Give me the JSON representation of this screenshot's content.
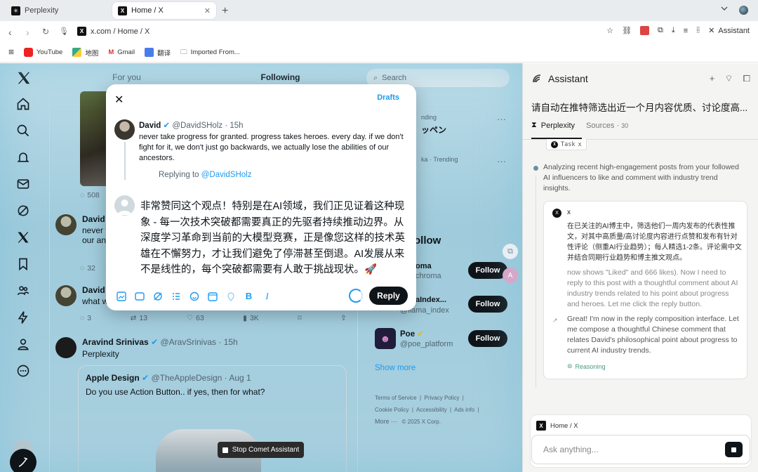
{
  "browser": {
    "tabs": [
      {
        "label": "Perplexity"
      },
      {
        "label": "Home / X"
      }
    ],
    "url": "x.com / Home / X",
    "assistant_label": "Assistant",
    "bookmarks": [
      "YouTube",
      "地图",
      "Gmail",
      "翻译",
      "Imported From..."
    ]
  },
  "x": {
    "feed_tabs": [
      "For you",
      "Following"
    ],
    "search_placeholder": "Search",
    "posts": [
      {
        "name": "David",
        "snippet": [
          "never ta",
          "our anc"
        ],
        "reply_count": "32"
      },
      {
        "name": "David",
        "snippet": [
          "what wa"
        ],
        "reply_count": "3",
        "repost_count": "13",
        "like_count": "63",
        "view_count": "3K"
      }
    ],
    "top_metric": "508",
    "aravind": {
      "name": "Aravind Srinivas",
      "handle": "@AravSrinivas",
      "time": "15h",
      "text": "Perplexity"
    },
    "quoted": {
      "name": "Apple Design",
      "handle": "@TheAppleDesign",
      "time": "Aug 1",
      "text": "Do you use Action Button.. if yes, then for what?"
    },
    "trending": [
      {
        "sub": "nding",
        "main": "ッペン"
      },
      {
        "sub": "ka · Trending",
        "main": ""
      }
    ],
    "who_title": "ollow",
    "who": [
      {
        "name": "oma",
        "handle": "chroma",
        "follow": "Follow"
      },
      {
        "name": "aIndex...",
        "handle": "@llama_index",
        "follow": "Follow"
      },
      {
        "name": "Poe",
        "handle": "@poe_platform",
        "follow": "Follow"
      }
    ],
    "show_more": "Show more",
    "footer": [
      "Terms of Service",
      "Privacy Policy",
      "Cookie Policy",
      "Accessibility",
      "Ads info",
      "More ···",
      "© 2025 X Corp."
    ]
  },
  "modal": {
    "drafts": "Drafts",
    "orig_name": "David",
    "orig_handle": "@DavidSHolz · 15h",
    "orig_text": "never take progress for granted. progress takes heroes. every day. if we don't fight for it, we don't just go backwards, we actually lose the abilities of our ancestors.",
    "replying_prefix": "Replying to ",
    "replying_handle": "@DavidSHolz",
    "compose_text": "非常赞同这个观点！特别是在AI领域，我们正见证着这种现象 - 每一次技术突破都需要真正的先驱者持续推动边界。从深度学习革命到当前的大模型竞赛，正是像您这样的技术英雄在不懈努力，才让我们避免了停滞甚至倒退。AI发展从来不是线性的，每个突破都需要有人敢于挑战现状。🚀",
    "reply_button": "Reply"
  },
  "stop_button": "Stop Comet Assistant",
  "assistant": {
    "title": "Assistant",
    "query": "请自动在推特筛选出近一个月内容优质、讨论度高...",
    "tab_perplexity": "Perplexity",
    "tab_sources": "Sources",
    "sources_count": "30",
    "task_chip": "Task",
    "task_chip_x": "x",
    "analyzing": "Analyzing recent high-engagement posts from your followed AI influencers to like and comment with industry trend insights.",
    "card_label": "x",
    "card_cn": "在已关注的AI博主中，筛选他们一周内发布的代表性推文，对其中高质量/高讨论度内容进行点赞和发布有针对性评论（侧重AI行业趋势）；每人精选1-2条。评论需中文并结合同期行业趋势和博主推文观点。",
    "step1": "now shows \"Liked\" and 666 likes). Now I need to reply to this post with a thoughtful comment about AI industry trends related to his point about progress and heroes. Let me click the reply button.",
    "step2": "Great! I'm now in the reply composition interface. Let me compose a thoughtful Chinese comment that relates David's philosophical point about progress to current AI industry trends.",
    "reasoning": "Reasoning",
    "context_label": "Home / X",
    "ask_placeholder": "Ask anything..."
  },
  "colors": {
    "accent": "#1d9bf0",
    "dark": "#0f1419",
    "verified": "#1d9bf0",
    "reasoning": "#4a9a82"
  }
}
